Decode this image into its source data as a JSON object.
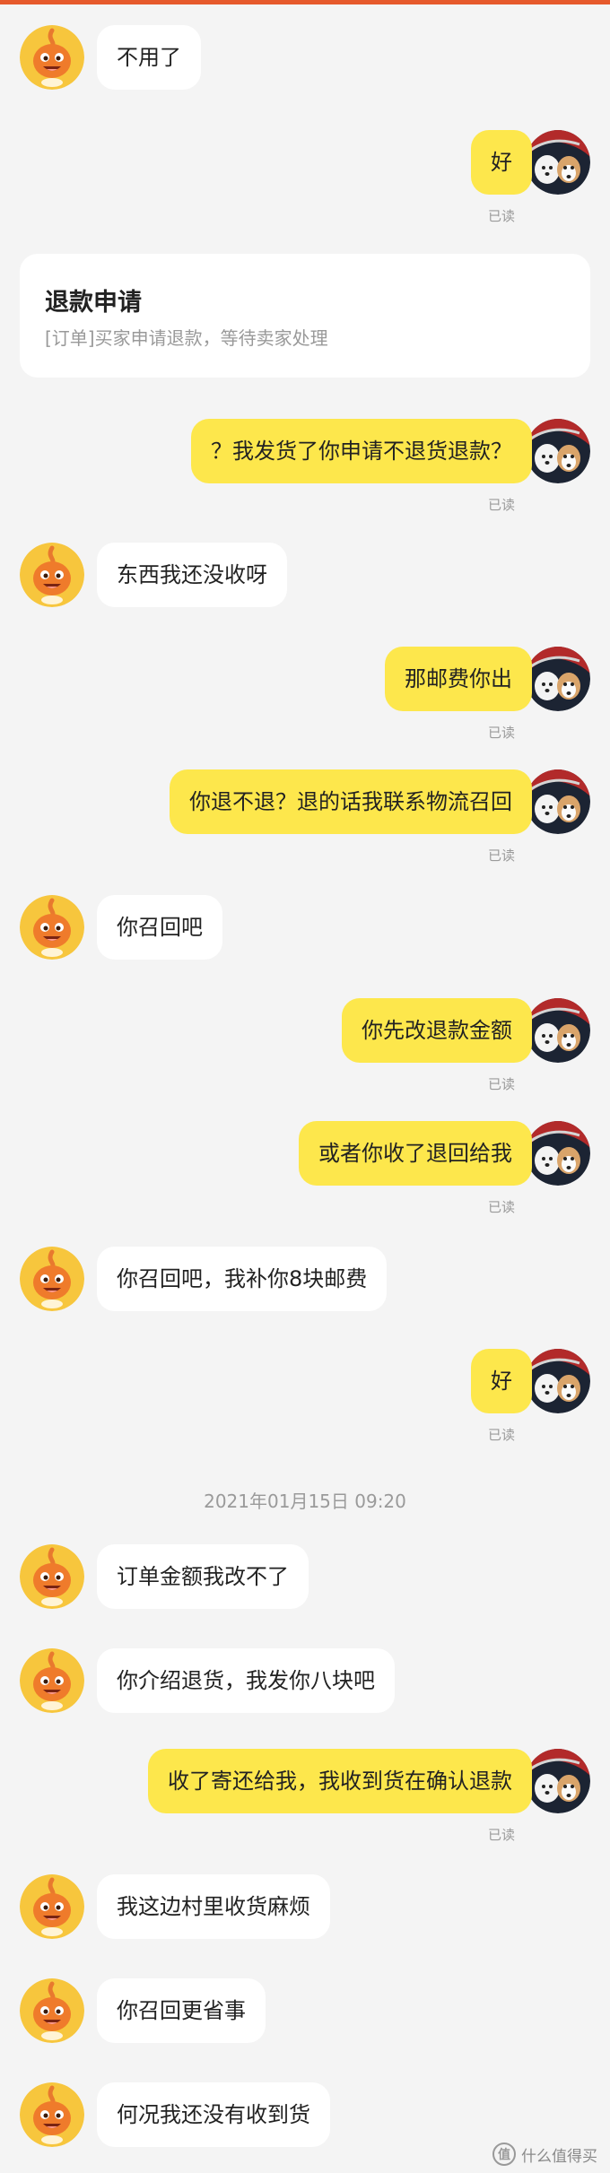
{
  "colors": {
    "accent_bar": "#e65a2c",
    "self_bubble": "#fde74c",
    "other_bubble": "#ffffff",
    "background": "#f4f4f4"
  },
  "card": {
    "title": "退款申请",
    "subtitle": "[订单]买家申请退款，等待卖家处理"
  },
  "timestamp": "2021年01月15日 09:20",
  "read_label": "已读",
  "messages": [
    {
      "side": "left",
      "text": "不用了"
    },
    {
      "side": "right",
      "text": "好"
    },
    {
      "side": "right",
      "text": "？我发货了你申请不退货退款？"
    },
    {
      "side": "left",
      "text": "东西我还没收呀"
    },
    {
      "side": "right",
      "text": "那邮费你出"
    },
    {
      "side": "right",
      "text": "你退不退？退的话我联系物流召回"
    },
    {
      "side": "left",
      "text": "你召回吧"
    },
    {
      "side": "right",
      "text": "你先改退款金额"
    },
    {
      "side": "right",
      "text": "或者你收了退回给我"
    },
    {
      "side": "left",
      "text": "你召回吧，我补你8块邮费"
    },
    {
      "side": "right",
      "text": "好"
    },
    {
      "side": "left",
      "text": "订单金额我改不了"
    },
    {
      "side": "left",
      "text": "你介绍退货，我发你八块吧"
    },
    {
      "side": "right",
      "text": "收了寄还给我，我收到货在确认退款"
    },
    {
      "side": "left",
      "text": "我这边村里收货麻烦"
    },
    {
      "side": "left",
      "text": "你召回更省事"
    },
    {
      "side": "left",
      "text": "何况我还没有收到货"
    }
  ],
  "watermark": {
    "logo_glyph": "值",
    "text": "什么值得买"
  }
}
